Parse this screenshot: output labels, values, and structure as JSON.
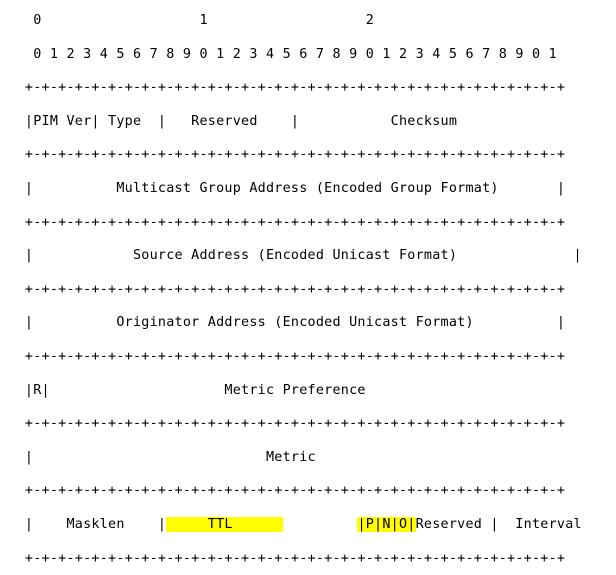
{
  "document": {
    "title": "PIM Message Packet Format",
    "type": "ascii-packet-diagram",
    "font": "monospace",
    "background_color": "#ffffff",
    "text_color": "#000000",
    "highlight_color": "#ffff00"
  },
  "bit_ruler": {
    "word_numbers_line": "    0                   1                   2",
    "bit_digits_line": "    0 1 2 3 4 5 6 7 8 9 0 1 2 3 4 5 6 7 8 9 0 1 2 3 4 5 6 7 8 9 0 1",
    "word_numbers": [
      "0",
      "1",
      "2"
    ],
    "bit_digits": [
      "0",
      "1",
      "2",
      "3",
      "4",
      "5",
      "6",
      "7",
      "8",
      "9",
      "0",
      "1",
      "2",
      "3",
      "4",
      "5",
      "6",
      "7",
      "8",
      "9",
      "0",
      "1",
      "2",
      "3",
      "4",
      "5",
      "6",
      "7",
      "8",
      "9",
      "0",
      "1"
    ]
  },
  "separator": "   +-+-+-+-+-+-+-+-+-+-+-+-+-+-+-+-+-+-+-+-+-+-+-+-+-+-+-+-+-+-+-+-+",
  "rows": [
    {
      "name": "pim-header-row",
      "text": "   |PIM Ver| Type  |   Reserved    |           Checksum",
      "fields": [
        "PIM Ver",
        "Type",
        "Reserved",
        "Checksum"
      ]
    },
    {
      "name": "multicast-group-address-row",
      "text": "   |          Multicast Group Address (Encoded Group Format)       |",
      "fields": [
        "Multicast Group Address (Encoded Group Format)"
      ]
    },
    {
      "name": "source-address-row",
      "text": "   |            Source Address (Encoded Unicast Format)              |",
      "fields": [
        "Source Address (Encoded Unicast Format)"
      ]
    },
    {
      "name": "originator-address-row",
      "text": "   |          Originator Address (Encoded Unicast Format)          |",
      "fields": [
        "Originator Address (Encoded Unicast Format)"
      ]
    },
    {
      "name": "metric-preference-row",
      "text": "   |R|                     Metric Preference",
      "fields": [
        "R",
        "Metric Preference"
      ]
    },
    {
      "name": "metric-row",
      "text": "   |                            Metric",
      "fields": [
        "Metric"
      ]
    }
  ],
  "last_row": {
    "name": "masklen-ttl-pno-reserved-interval-row",
    "segments": [
      {
        "text": "   |    Masklen    |",
        "highlight": false
      },
      {
        "text": "     TTL      ",
        "highlight": true
      },
      {
        "text": "         ",
        "highlight": false
      },
      {
        "text": "|P|N|O|",
        "highlight": true
      },
      {
        "text": "Reserved |  Interval",
        "highlight": false
      }
    ],
    "fields": [
      "Masklen",
      "TTL",
      "P",
      "N",
      "O",
      "Reserved",
      "Interval"
    ],
    "highlighted_fields": [
      "TTL",
      "P",
      "N",
      "O"
    ]
  }
}
